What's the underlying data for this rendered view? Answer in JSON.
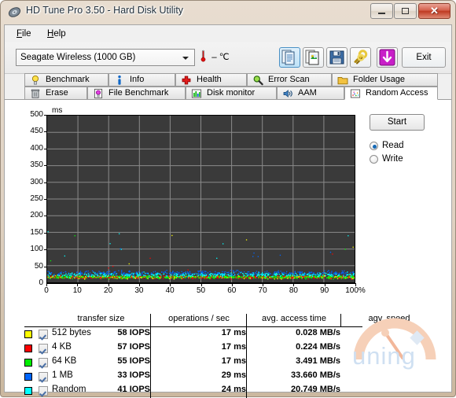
{
  "window": {
    "title": "HD Tune Pro 3.50 - Hard Disk Utility",
    "icon": "disk-platter-icon",
    "buttons": {
      "minimize": "minimize-button",
      "maximize": "restore-button",
      "close": "close-button",
      "close_glyph": "✕"
    }
  },
  "menu": {
    "items": [
      {
        "label": "File",
        "accel": "F"
      },
      {
        "label": "Help",
        "accel": "H"
      }
    ]
  },
  "toolbar": {
    "drive": {
      "selected": "Seagate Wireless (1000 GB)",
      "options": [
        "Seagate Wireless (1000 GB)"
      ]
    },
    "temperature": "– ℃",
    "buttons": [
      {
        "name": "copy-text-button",
        "icon": "copy-text-icon",
        "active": true
      },
      {
        "name": "copy-image-button",
        "icon": "copy-image-icon",
        "active": false
      },
      {
        "name": "save-button",
        "icon": "floppy-save-icon",
        "active": false
      },
      {
        "name": "options-button",
        "icon": "tools-icon",
        "active": false
      },
      {
        "name": "download-button",
        "icon": "down-arrow-icon",
        "active": false
      }
    ],
    "exit_label": "Exit"
  },
  "tabs": {
    "row1": [
      {
        "label": "Benchmark",
        "icon": "lightbulb-icon",
        "active": false
      },
      {
        "label": "Info",
        "icon": "info-icon",
        "active": false
      },
      {
        "label": "Health",
        "icon": "red-cross-icon",
        "active": false
      },
      {
        "label": "Error Scan",
        "icon": "magnifier-icon",
        "active": false
      },
      {
        "label": "Folder Usage",
        "icon": "folder-icon",
        "active": false
      }
    ],
    "row2": [
      {
        "label": "Erase",
        "icon": "trash-icon",
        "active": false
      },
      {
        "label": "File Benchmark",
        "icon": "document-bulb-icon",
        "active": false
      },
      {
        "label": "Disk monitor",
        "icon": "bar-chart-icon",
        "active": false
      },
      {
        "label": "AAM",
        "icon": "speaker-icon",
        "active": false
      },
      {
        "label": "Random Access",
        "icon": "scatter-icon",
        "active": true
      }
    ]
  },
  "controls": {
    "start_label": "Start",
    "mode_options": [
      {
        "label": "Read",
        "selected": true
      },
      {
        "label": "Write",
        "selected": false
      }
    ]
  },
  "chart_data": {
    "type": "scatter",
    "title": "",
    "xlabel": "",
    "ylabel": "ms",
    "unit_label": "ms",
    "xlim": [
      0,
      100
    ],
    "ylim": [
      0,
      500
    ],
    "x_ticks": [
      "0",
      "10",
      "20",
      "30",
      "40",
      "50",
      "60",
      "70",
      "80",
      "90",
      "100%"
    ],
    "y_ticks": [
      "0",
      "50",
      "100",
      "150",
      "200",
      "250",
      "300",
      "350",
      "400",
      "450",
      "500"
    ],
    "grid": true,
    "plot_bg": "#3a3a3a",
    "legend_position": "table-below",
    "series": [
      {
        "name": "512 bytes",
        "color": "#ffff00",
        "mean_ms": 17,
        "point_count": 420
      },
      {
        "name": "4 KB",
        "color": "#ff0000",
        "mean_ms": 17,
        "point_count": 420
      },
      {
        "name": "64 KB",
        "color": "#00ff00",
        "mean_ms": 17,
        "point_count": 420
      },
      {
        "name": "1 MB",
        "color": "#0066ff",
        "mean_ms": 29,
        "point_count": 420
      },
      {
        "name": "Random",
        "color": "#00ffff",
        "mean_ms": 24,
        "point_count": 420
      }
    ]
  },
  "table": {
    "headers": [
      "transfer size",
      "operations / sec",
      "avg. access time",
      "agv. speed"
    ],
    "rows": [
      {
        "color": "#ffff00",
        "checked": true,
        "size": "512 bytes",
        "iops": "58 IOPS",
        "access": "17 ms",
        "speed": "0.028 MB/s"
      },
      {
        "color": "#ff0000",
        "checked": true,
        "size": "4 KB",
        "iops": "57 IOPS",
        "access": "17 ms",
        "speed": "0.224 MB/s"
      },
      {
        "color": "#00ee00",
        "checked": true,
        "size": "64 KB",
        "iops": "55 IOPS",
        "access": "17 ms",
        "speed": "3.491 MB/s"
      },
      {
        "color": "#0066ff",
        "checked": true,
        "size": "1 MB",
        "iops": "33 IOPS",
        "access": "29 ms",
        "speed": "33.660 MB/s"
      },
      {
        "color": "#00ffff",
        "checked": true,
        "size": "Random",
        "iops": "41 IOPS",
        "access": "24 ms",
        "speed": "20.749 MB/s"
      }
    ]
  },
  "watermark": {
    "text": "uning",
    "icon": "gauge-icon"
  }
}
